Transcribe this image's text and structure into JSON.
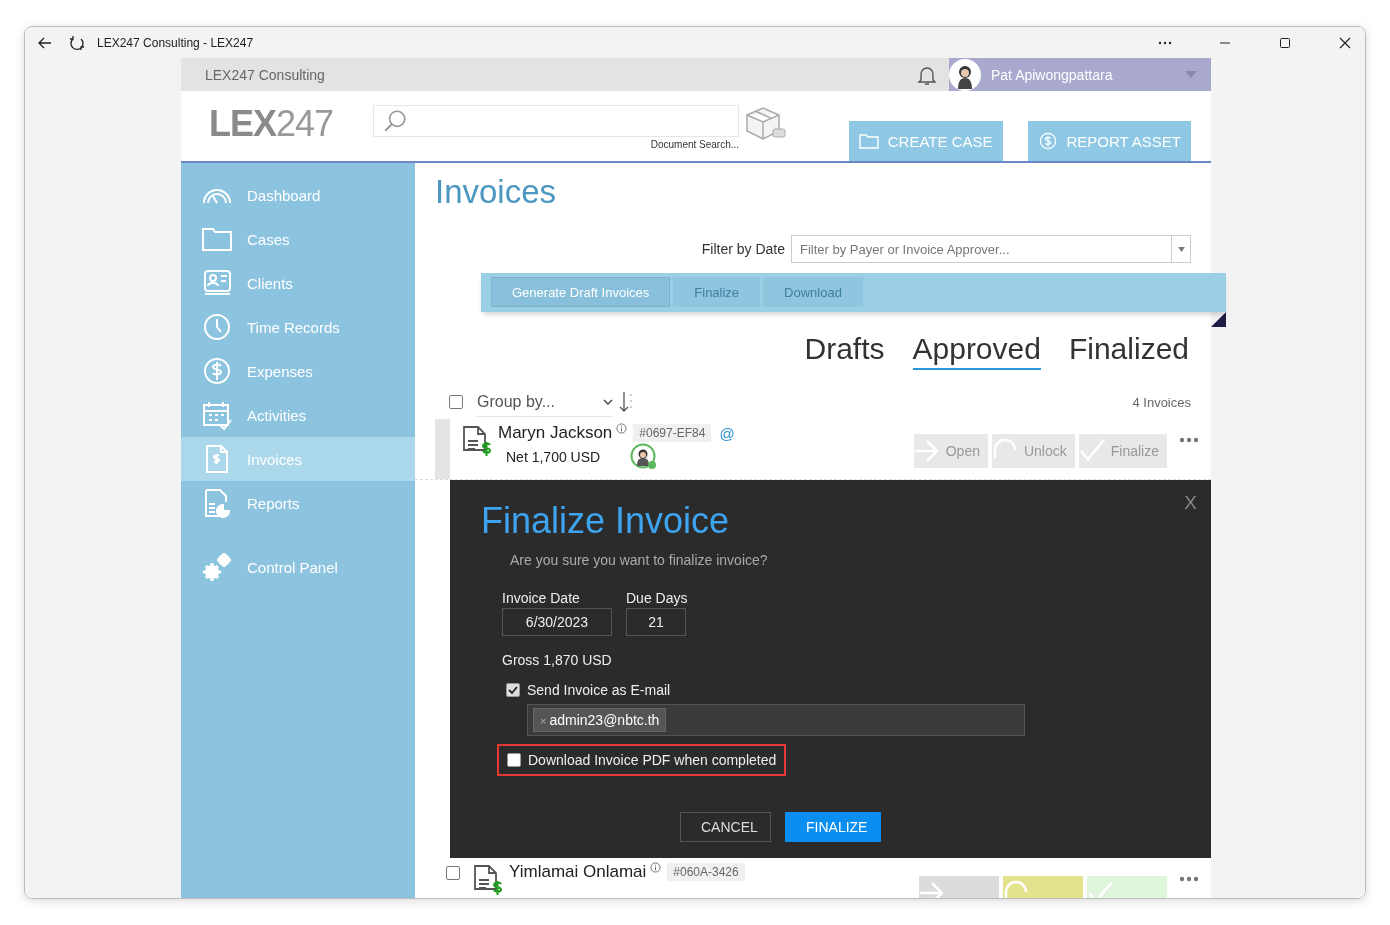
{
  "window": {
    "title": "LEX247 Consulting - LEX247"
  },
  "topbar": {
    "organization": "LEX247 Consulting",
    "user": "Pat Apiwongpattara"
  },
  "header": {
    "logo": {
      "bold": "LEX",
      "light": "247"
    },
    "search_caption": "Document Search...",
    "buttons": [
      {
        "label": "CREATE CASE"
      },
      {
        "label": "REPORT ASSET"
      }
    ]
  },
  "sidebar": {
    "items": [
      {
        "label": "Dashboard",
        "selected": false
      },
      {
        "label": "Cases",
        "selected": false
      },
      {
        "label": "Clients",
        "selected": false
      },
      {
        "label": "Time Records",
        "selected": false
      },
      {
        "label": "Expenses",
        "selected": false
      },
      {
        "label": "Activities",
        "selected": false
      },
      {
        "label": "Invoices",
        "selected": true
      },
      {
        "label": "Reports",
        "selected": false
      },
      {
        "label": "Control Panel",
        "selected": false
      }
    ]
  },
  "page_title": "Invoices",
  "filter": {
    "label": "Filter by Date",
    "placeholder": "Filter by Payer or Invoice Approver..."
  },
  "toolbar": [
    {
      "label": "Generate Draft Invoices",
      "disabled": false
    },
    {
      "label": "Finalize",
      "disabled": true
    },
    {
      "label": "Download",
      "disabled": true
    }
  ],
  "tabs": [
    {
      "label": "Drafts",
      "selected": false
    },
    {
      "label": "Approved",
      "selected": true
    },
    {
      "label": "Finalized",
      "selected": false
    }
  ],
  "list": {
    "select_all": {
      "checked": false
    },
    "group_by": {
      "placeholder": "Group by..."
    },
    "count": "4 Invoices",
    "rows": [
      {
        "name": "Maryn Jackson",
        "net": "Net 1,700 USD",
        "number": "#0697-EF84",
        "email_mark": "@",
        "actions": [
          {
            "label": "Open",
            "color": "#e8e8e8"
          },
          {
            "label": "Unlock",
            "color": "#e8e8e8"
          },
          {
            "label": "Finalize",
            "color": "#e8e8e8"
          }
        ]
      },
      {
        "name": "Yimlamai Onlamai",
        "number": "#060A-3426",
        "checked": false,
        "actions": [
          {
            "color": "#dcdcdc"
          },
          {
            "color": "#e3e38e"
          },
          {
            "color": "#dff5dc"
          }
        ]
      }
    ]
  },
  "dialog": {
    "title": "Finalize Invoice",
    "close": "X",
    "question": "Are you sure you want to finalize invoice?",
    "date_label": "Invoice Date",
    "date_value": "6/30/2023",
    "due_label": "Due Days",
    "due_value": "21",
    "gross": "Gross 1,870 USD",
    "send_email": {
      "label": "Send Invoice as E-mail",
      "checked": true
    },
    "recipients": [
      {
        "remove": "×",
        "email": "admin23@nbtc.th"
      }
    ],
    "download_pdf": {
      "label": "Download Invoice PDF when completed",
      "checked": false,
      "highlighted": true
    },
    "buttons": [
      {
        "label": "CANCEL",
        "kind": "secondary"
      },
      {
        "label": "FINALIZE",
        "kind": "primary"
      }
    ]
  }
}
